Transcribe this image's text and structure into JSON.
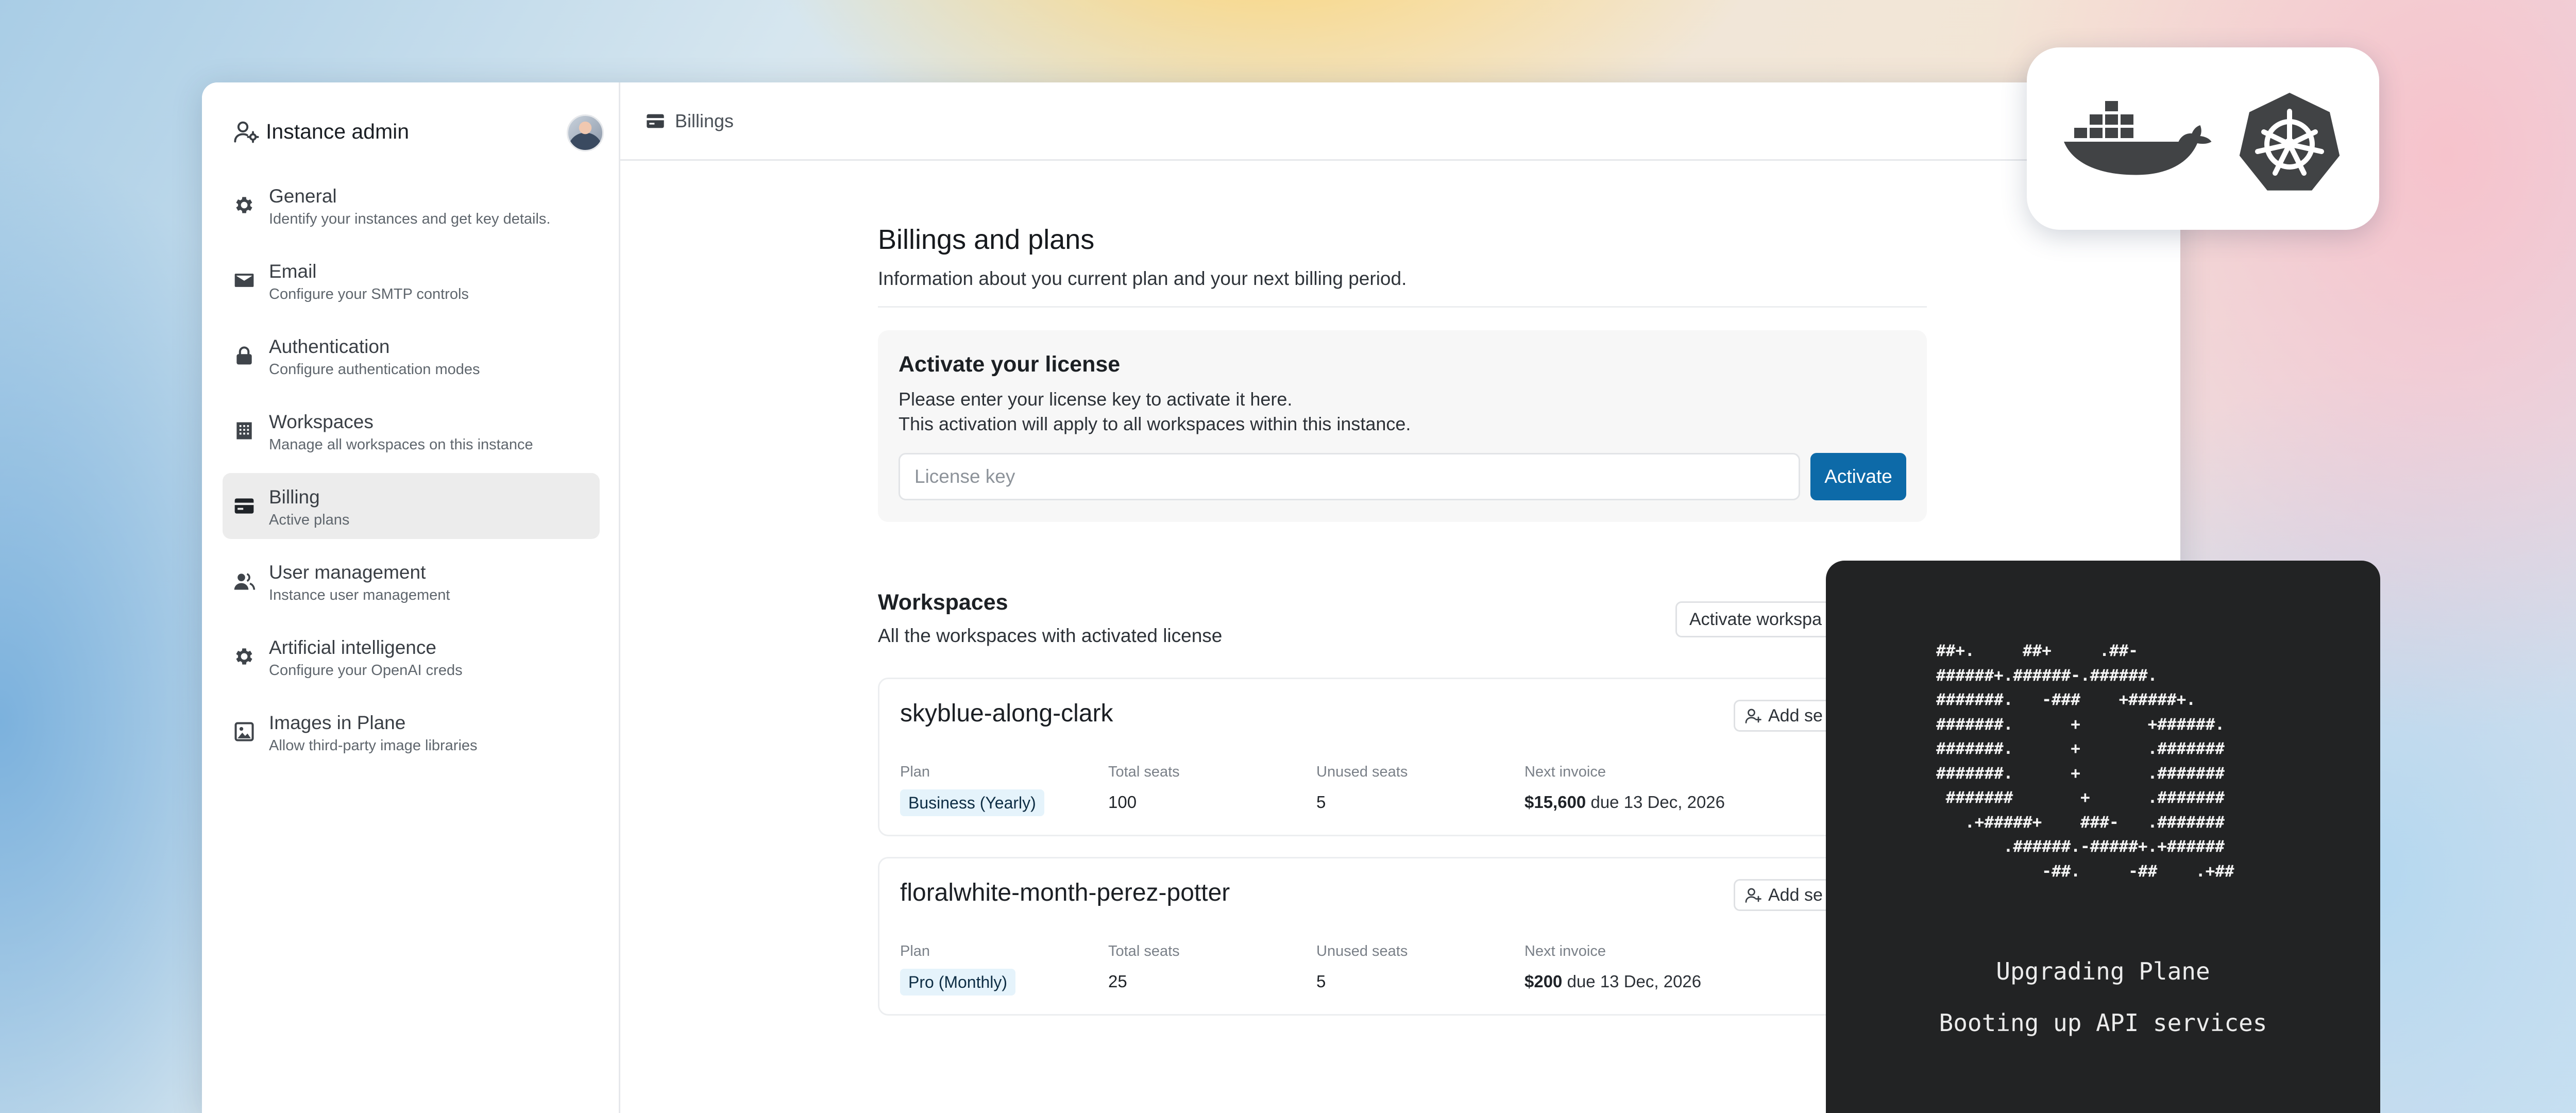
{
  "sidebar": {
    "title": "Instance admin",
    "items": [
      {
        "label": "General",
        "description": "Identify your instances and get key details.",
        "icon": "gear-icon"
      },
      {
        "label": "Email",
        "description": "Configure your SMTP controls",
        "icon": "mail-icon"
      },
      {
        "label": "Authentication",
        "description": "Configure authentication modes",
        "icon": "lock-icon"
      },
      {
        "label": "Workspaces",
        "description": "Manage all workspaces on this instance",
        "icon": "building-icon"
      },
      {
        "label": "Billing",
        "description": "Active plans",
        "icon": "credit-card-icon",
        "active": true
      },
      {
        "label": "User management",
        "description": "Instance user management",
        "icon": "users-icon"
      },
      {
        "label": "Artificial intelligence",
        "description": "Configure your OpenAI creds",
        "icon": "gear-icon"
      },
      {
        "label": "Images in Plane",
        "description": "Allow third-party image libraries",
        "icon": "image-icon"
      }
    ]
  },
  "topbar": {
    "breadcrumb": "Billings",
    "icon": "credit-card-icon"
  },
  "main": {
    "title": "Billings and plans",
    "subtitle": "Information about you current plan and your next billing period.",
    "license": {
      "title": "Activate your license",
      "desc_line1": "Please enter your license key to activate it here.",
      "desc_line2": "This activation will apply to all workspaces within this instance.",
      "input_placeholder": "License key",
      "input_value": "",
      "button_label": "Activate"
    },
    "workspaces": {
      "title": "Workspaces",
      "subtitle": "All the workspaces with activated license",
      "activate_button": "Activate workspa",
      "add_seats_label": "Add se",
      "col_plan": "Plan",
      "col_total": "Total seats",
      "col_unused": "Unused seats",
      "col_invoice": "Next invoice",
      "items": [
        {
          "name": "skyblue-along-clark",
          "plan": "Business (Yearly)",
          "total_seats": "100",
          "unused_seats": "5",
          "invoice_amount": "$15,600",
          "invoice_due": "due 13 Dec, 2026"
        },
        {
          "name": "floralwhite-month-perez-potter",
          "plan": "Pro (Monthly)",
          "total_seats": "25",
          "unused_seats": "5",
          "invoice_amount": "$200",
          "invoice_due": "due 13 Dec, 2026"
        }
      ]
    }
  },
  "console": {
    "ascii_art": "##+.     ##+     .##-\n######+.######-.######.\n#######.   -###    +#####+.\n#######.      +       +######.\n#######.      +       .#######\n#######.      +       .#######\n #######       +      .#######\n   .+#####+    ###-   .#######\n       .######.-#####+.+######\n           -##.     -##    .+##",
    "title": "Upgrading Plane",
    "status": "Booting up API services"
  },
  "colors": {
    "accent": "#0d6aa8",
    "active_nav": "#ececec",
    "console_bg": "#222324",
    "badge_bg": "#e5f3fb"
  },
  "logos": [
    "docker-icon",
    "kubernetes-icon"
  ]
}
